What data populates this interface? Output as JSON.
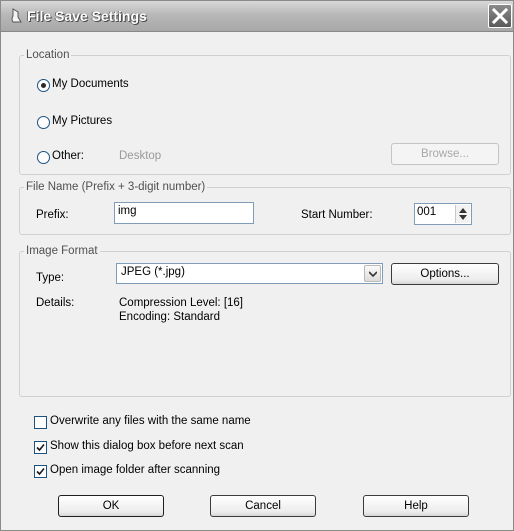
{
  "window": {
    "title": "File Save Settings"
  },
  "location": {
    "legend": "Location",
    "my_documents": "My Documents",
    "my_pictures": "My Pictures",
    "other": "Other:",
    "other_path": "Desktop",
    "browse": "Browse...",
    "selected": "my_documents"
  },
  "filename": {
    "legend": "File Name (Prefix + 3-digit number)",
    "prefix_label": "Prefix:",
    "prefix_value": "img",
    "start_label": "Start Number:",
    "start_value": "001"
  },
  "format": {
    "legend": "Image Format",
    "type_label": "Type:",
    "type_value": "JPEG (*.jpg)",
    "options": "Options...",
    "details_label": "Details:",
    "details_line1": "Compression Level: [16]",
    "details_line2": "Encoding: Standard"
  },
  "checks": {
    "overwrite": {
      "label": "Overwrite any files with the same name",
      "checked": false
    },
    "show_dialog": {
      "label": "Show this dialog box before next scan",
      "checked": true
    },
    "open_folder": {
      "label": "Open image folder after scanning",
      "checked": true
    }
  },
  "buttons": {
    "ok": "OK",
    "cancel": "Cancel",
    "help": "Help"
  },
  "colors": {
    "frame": "#f0f0f0",
    "border": "#1c5180"
  }
}
